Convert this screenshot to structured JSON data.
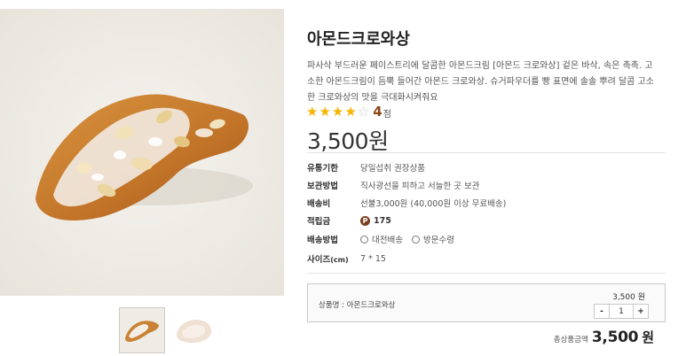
{
  "product": {
    "title": "아몬드크로와상",
    "description_lines": [
      "파사삭 부드러운 페이스트리에 달콤한 아몬드크림 [아몬드 크로와상] 겉은 바삭, 속은 촉촉. 고",
      "소한 아몬드크림이 듬뿍 들어간 아몬드 크로와상. 슈거파우더를 빵 표면에 솔솔 뿌려 달콤 고소",
      "한 크로와상의 맛을 극대화시켜줘요"
    ],
    "rating": {
      "value": "4",
      "unit": "점",
      "stars_filled": 4,
      "stars_total": 5,
      "star_color": "#f5b400"
    },
    "price": "3,500원"
  },
  "info": {
    "expiry": {
      "label": "유통기한",
      "value": "당일섭취 권장상품"
    },
    "storage": {
      "label": "보관방법",
      "value": "직사광선을 피하고 서늘한 곳 보관"
    },
    "shipping_fee": {
      "label": "배송비",
      "value_main": "선불3,000원",
      "value_sub": "(40,000원 이상 무료배송)"
    },
    "points": {
      "label": "적립금",
      "badge": "P",
      "value": "175",
      "badge_color": "#7a3e1d"
    },
    "delivery": {
      "label": "배송방법",
      "options": [
        "대전배송",
        "방문수령"
      ]
    },
    "size": {
      "label": "사이즈",
      "label_unit": "(cm)",
      "value": "7 * 15"
    }
  },
  "option": {
    "name": "상품명 : 아몬드크로와상",
    "price": "3,500 원",
    "qty": "1",
    "minus": "-",
    "plus": "+"
  },
  "total": {
    "label": "총상품금액",
    "amount": "3,500",
    "unit": "원"
  },
  "icons": {
    "star": "star-icon",
    "points": "points-badge-icon",
    "radio": "radio-icon"
  }
}
